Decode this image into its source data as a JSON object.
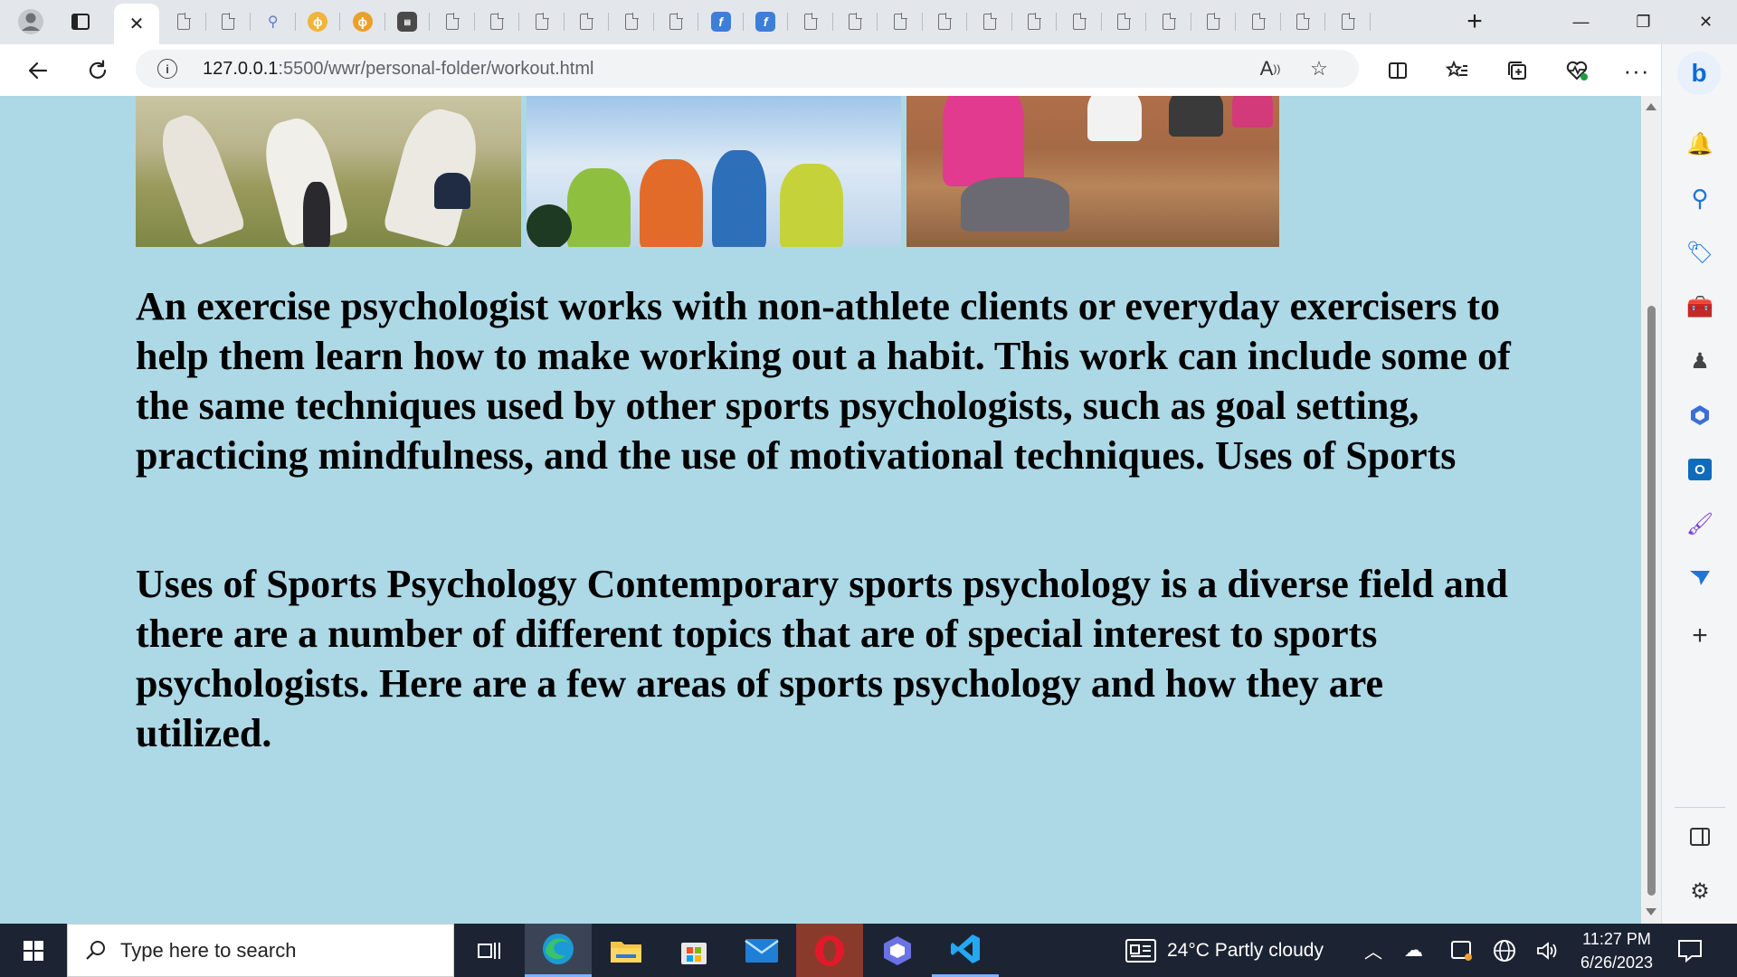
{
  "browser": {
    "active_tab_close": "✕",
    "new_tab_label": "+",
    "window_controls": {
      "minimize": "—",
      "restore": "❐",
      "close": "✕"
    },
    "address": {
      "host": "127.0.0.1",
      "path": ":5500/wwr/personal-folder/workout.html"
    }
  },
  "page": {
    "paragraphs": [
      "An exercise psychologist works with non-athlete clients or everyday exercisers to help them learn how to make working out a habit. This work can include some of the same techniques used by other sports psychologists, such as goal setting, practicing mindfulness, and the use of motivational techniques. Uses of Sports",
      "Uses of Sports Psychology Contemporary sports psychology is a diverse field and there are a number of different topics that are of special interest to sports psychologists. Here are a few areas of sports psychology and how they are utilized."
    ]
  },
  "taskbar": {
    "search_placeholder": "Type here to search",
    "weather": "24°C  Partly cloudy",
    "time": "11:27 PM",
    "date": "6/26/2023"
  }
}
